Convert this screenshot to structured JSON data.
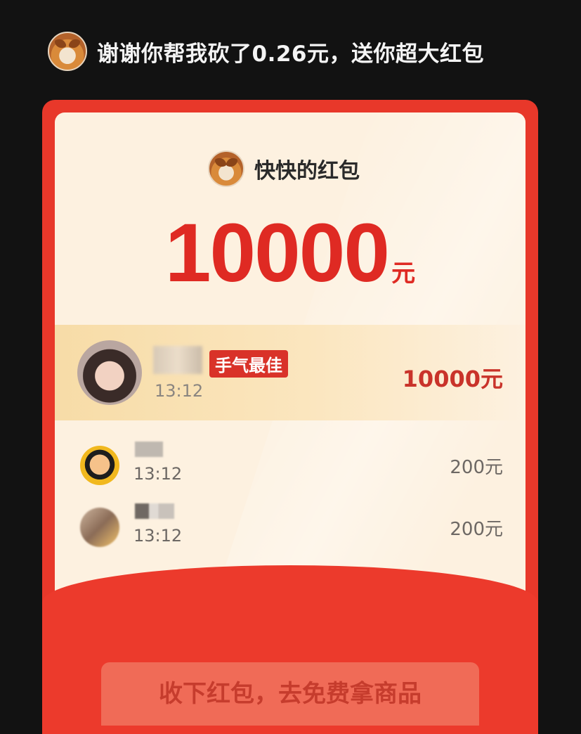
{
  "header": {
    "message": "谢谢你帮我砍了0.26元，送你超大红包",
    "avatar_icon": "shiba-dog-avatar-icon"
  },
  "envelope": {
    "sender_name": "快快的红包",
    "amount": "10000",
    "unit": "元",
    "best_luck": {
      "badge": "手气最佳",
      "time": "13:12",
      "amount": "10000元"
    },
    "claims": [
      {
        "time": "13:12",
        "amount": "200元"
      },
      {
        "time": "13:12",
        "amount": "200元"
      }
    ],
    "button_label": "收下红包，去免费拿商品"
  },
  "colors": {
    "envelope_red": "#e8382a",
    "amount_red": "#df2a23",
    "card_bg": "#fdf1e0"
  }
}
